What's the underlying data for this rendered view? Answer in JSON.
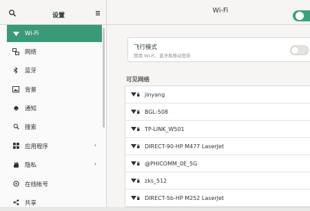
{
  "header": {
    "sidebar_title": "设置",
    "main_title": "Wi-Fi",
    "wifi_enabled": true
  },
  "sidebar": {
    "items": [
      {
        "label": "Wi-Fi",
        "icon": "wifi-icon",
        "active": true
      },
      {
        "label": "网络",
        "icon": "network-icon"
      },
      {
        "label": "蓝牙",
        "icon": "bluetooth-icon"
      },
      {
        "label": "背景",
        "icon": "background-icon"
      },
      {
        "label": "通知",
        "icon": "bell-icon"
      },
      {
        "label": "搜索",
        "icon": "search-icon"
      },
      {
        "label": "应用程序",
        "icon": "apps-icon",
        "chevron": true
      },
      {
        "label": "隐私",
        "icon": "hand-icon",
        "chevron": true
      },
      {
        "label": "在线帐号",
        "icon": "online-accounts-icon"
      },
      {
        "label": "共享",
        "icon": "share-icon"
      }
    ]
  },
  "airplane": {
    "title": "飞行模式",
    "description": "禁用 Wi-Fi、蓝牙和移动宽带",
    "enabled": false
  },
  "networks": {
    "section_title": "可见网络",
    "items": [
      "jinyang",
      "BGL-508",
      "TP-LINK_W501",
      "DIRECT-90-HP M477 LaserJet",
      "@PHICOMM_0E_5G",
      "zks_512",
      "DIRECT-5b-HP M252 LaserJet"
    ]
  },
  "colors": {
    "accent": "#3a9a78",
    "toggle_on": "#3aa17b"
  }
}
